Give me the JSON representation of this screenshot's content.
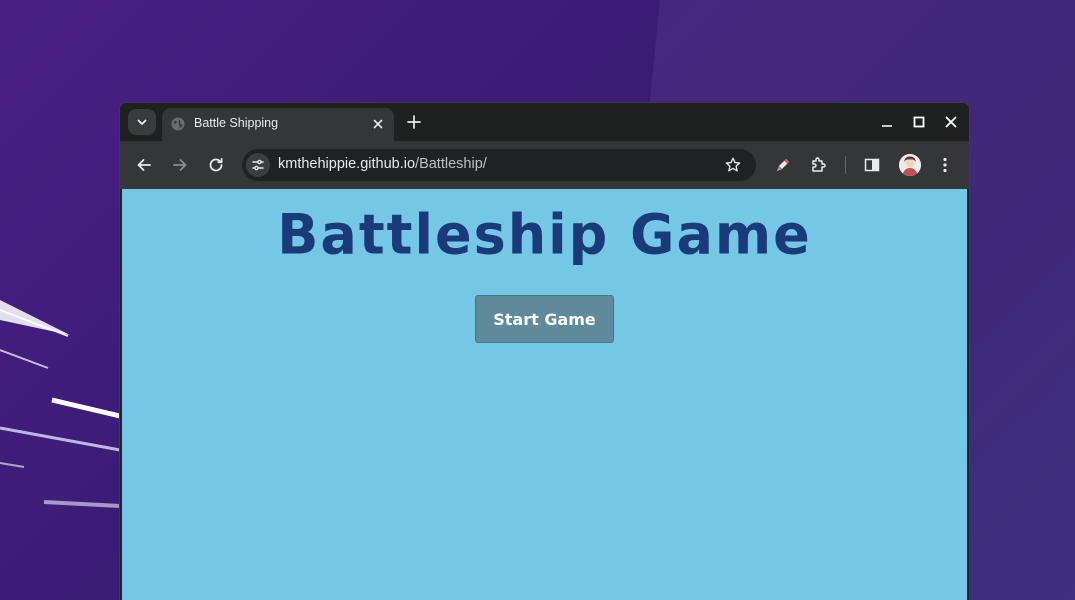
{
  "browser": {
    "tab": {
      "title": "Battle Shipping"
    },
    "omnibox": {
      "host": "kmthehippie.github.io",
      "path": "/Battleship/"
    }
  },
  "page": {
    "title": "Battleship Game",
    "start_button_label": "Start Game"
  },
  "colors": {
    "page_background": "#74c7e5",
    "title_color": "#1b3a7a",
    "button_background": "#5e8a9b"
  },
  "icons": {
    "tab_search": "chevron-down-icon",
    "favicon": "globe-icon",
    "tab_close": "close-icon",
    "new_tab": "plus-icon",
    "back": "arrow-left-icon",
    "forward": "arrow-right-icon",
    "reload": "reload-icon",
    "site_info": "tune-icon",
    "bookmark": "star-icon",
    "extension_pen": "pen-icon",
    "extensions": "puzzle-icon",
    "side_panel": "side-panel-icon",
    "profile": "avatar",
    "menu": "kebab-menu-icon",
    "minimize": "minimize-icon",
    "maximize": "maximize-icon",
    "close_window": "close-window-icon"
  }
}
